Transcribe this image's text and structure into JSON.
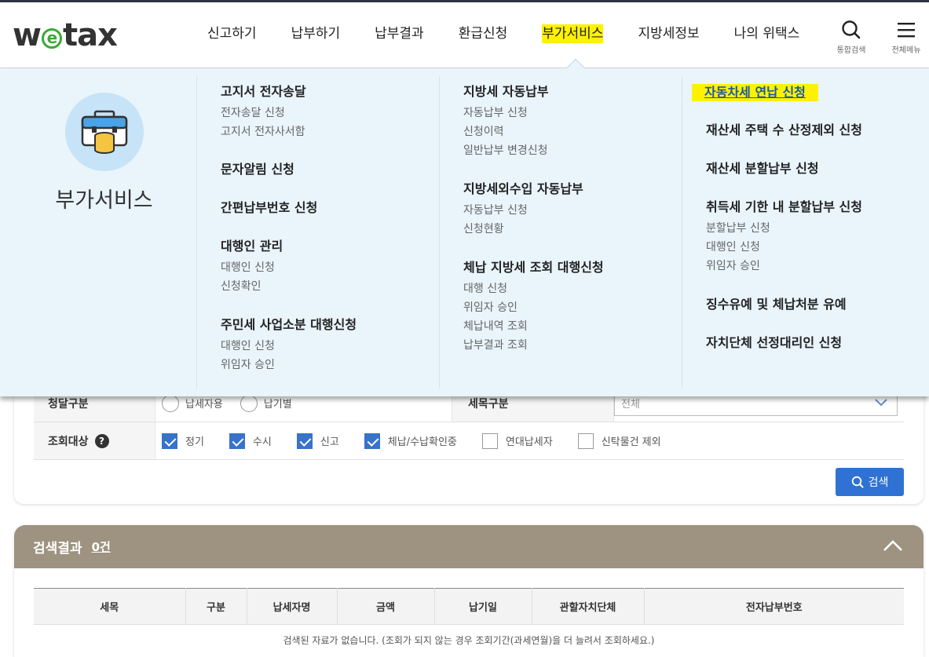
{
  "header": {
    "logo": {
      "pre": "w",
      "mid": "e",
      "post": "tax"
    },
    "nav": [
      {
        "label": "신고하기",
        "active": false
      },
      {
        "label": "납부하기",
        "active": false
      },
      {
        "label": "납부결과",
        "active": false
      },
      {
        "label": "환급신청",
        "active": false
      },
      {
        "label": "부가서비스",
        "active": true
      },
      {
        "label": "지방세정보",
        "active": false
      },
      {
        "label": "나의 위택스",
        "active": false
      }
    ],
    "search_label": "통합검색",
    "menu_label": "전체메뉴"
  },
  "mega": {
    "title": "부가서비스",
    "col1": [
      {
        "title": "고지서 전자송달",
        "items": [
          "전자송달 신청",
          "고지서 전자사서함"
        ]
      },
      {
        "title": "문자알림 신청",
        "items": []
      },
      {
        "title": "간편납부번호 신청",
        "items": []
      },
      {
        "title": "대행인 관리",
        "items": [
          "대행인 신청",
          "신청확인"
        ]
      },
      {
        "title": "주민세 사업소분 대행신청",
        "items": [
          "대행인 신청",
          "위임자 승인"
        ]
      }
    ],
    "col2": [
      {
        "title": "지방세 자동납부",
        "items": [
          "자동납부 신청",
          "신청이력",
          "일반납부 변경신청"
        ]
      },
      {
        "title": "지방세외수입 자동납부",
        "items": [
          "자동납부 신청",
          "신청현황"
        ]
      },
      {
        "title": "체납 지방세 조회 대행신청",
        "items": [
          "대행 신청",
          "위임자 승인",
          "체납내역 조회",
          "납부결과 조회"
        ]
      }
    ],
    "col3": [
      {
        "title": "자동차세 연납 신청",
        "items": [],
        "highlight": true
      },
      {
        "title": "재산세 주택 수 산정제외 신청",
        "items": []
      },
      {
        "title": "재산세 분할납부 신청",
        "items": []
      },
      {
        "title": "취득세 기한 내 분할납부 신청",
        "items": [
          "분할납부 신청",
          "대행인 신청",
          "위임자 승인"
        ]
      },
      {
        "title": "징수유예 및 체납처분 유예",
        "items": []
      },
      {
        "title": "자치단체 선정대리인 신청",
        "items": []
      }
    ]
  },
  "search_form": {
    "row1_label": "청달구분",
    "row1_options": [
      "납세자용",
      "납기별"
    ],
    "row1_right_label": "세목구분",
    "row1_select": "전체",
    "target_label": "조회대상",
    "targets": [
      {
        "label": "정기",
        "checked": true
      },
      {
        "label": "수시",
        "checked": true
      },
      {
        "label": "신고",
        "checked": true
      },
      {
        "label": "체납/수납확인중",
        "checked": true
      },
      {
        "label": "연대납세자",
        "checked": false
      },
      {
        "label": "신탁물건 제외",
        "checked": false
      }
    ],
    "search_button": "검색"
  },
  "results": {
    "title": "검색결과",
    "count": "0건",
    "columns": [
      "세목",
      "구분",
      "납세자명",
      "금액",
      "납기일",
      "관할자치단체",
      "전자납부번호"
    ],
    "empty_message": "검색된 자료가 없습니다. (조회가 되지 않는 경우 조회기간(과세연월)을 더 늘려서 조회하세요.)"
  }
}
